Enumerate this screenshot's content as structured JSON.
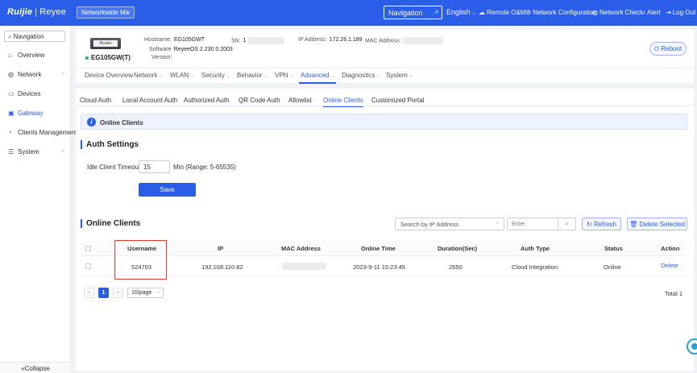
{
  "topbar": {
    "logo_brand": "Ruijie",
    "logo_sep": "|",
    "logo_sub": "Reyee",
    "network_select": "Networkwide Ma",
    "nav_search": "Navigation",
    "language": "English",
    "links": [
      "Remote O&M",
      "Network Configuration",
      "Network Check",
      "Alert",
      "Log Out"
    ]
  },
  "sidebar": {
    "nav_label": "Navigation",
    "items": [
      {
        "label": "Overview",
        "icon": "home-icon"
      },
      {
        "label": "Network",
        "icon": "globe-icon"
      },
      {
        "label": "Devices",
        "icon": "devices-icon"
      },
      {
        "label": "Gateway",
        "icon": "gateway-icon"
      },
      {
        "label": "Clients Management",
        "icon": "clients-icon"
      },
      {
        "label": "System",
        "icon": "system-icon"
      }
    ],
    "collapse": "Collapse"
  },
  "device": {
    "router_tag": "Router",
    "model": "EG105GW(T)",
    "hostname_label": "Hostname:",
    "hostname": "EG105GWT",
    "sn_label": "SN:",
    "sn": "1",
    "ip_label": "IP Address:",
    "ip": "172.26.1.189",
    "mac_label": "MAC Address:",
    "software_label": "Software",
    "software": "ReyeeOS 2.230.0.2003",
    "version_label": "Version:",
    "reboot": "Reboot"
  },
  "top_tabs": [
    {
      "label": "Device Overview",
      "dropdown": false
    },
    {
      "label": "Network",
      "dropdown": true
    },
    {
      "label": "WLAN",
      "dropdown": true
    },
    {
      "label": "Security",
      "dropdown": true
    },
    {
      "label": "Behavior",
      "dropdown": true
    },
    {
      "label": "VPN",
      "dropdown": true
    },
    {
      "label": "Advanced",
      "dropdown": true
    },
    {
      "label": "Diagnostics",
      "dropdown": true
    },
    {
      "label": "System",
      "dropdown": true
    }
  ],
  "sub_tabs": [
    "Cloud Auth",
    "Local Account Auth",
    "Authorized Auth",
    "QR Code Auth",
    "Allowlist",
    "Online Clients",
    "Customized Portal"
  ],
  "banner": {
    "text": "Online Clients"
  },
  "auth_settings": {
    "title": "Auth Settings",
    "timeout_label": "Idle Client Timeout",
    "timeout_value": "15",
    "timeout_hint": "Min (Range: 5-65535)",
    "save": "Save"
  },
  "online_clients": {
    "title": "Online Clients",
    "search_select": "Search by IP Address",
    "search_placeholder": "Enter",
    "refresh": "Refresh",
    "delete_selected": "Delete Selected",
    "columns": [
      "Username",
      "IP",
      "MAC Address",
      "Online Time",
      "Duration(Sec)",
      "Auth Type",
      "Status",
      "Action"
    ],
    "rows": [
      {
        "username": "524703",
        "ip": "192.168.110.82",
        "mac": "",
        "online_time": "2023-9-11 15:23:45",
        "duration": "2650",
        "auth_type": "Cloud Integration",
        "status": "Online",
        "action": "Delete"
      }
    ],
    "pager": {
      "prev": "<",
      "current": "1",
      "next": ">",
      "page_size": "10/page",
      "total": "Total 1"
    }
  },
  "colors": {
    "primary": "#2a5ee8",
    "highlight": "#e03b3b",
    "online": "#27ae60"
  }
}
